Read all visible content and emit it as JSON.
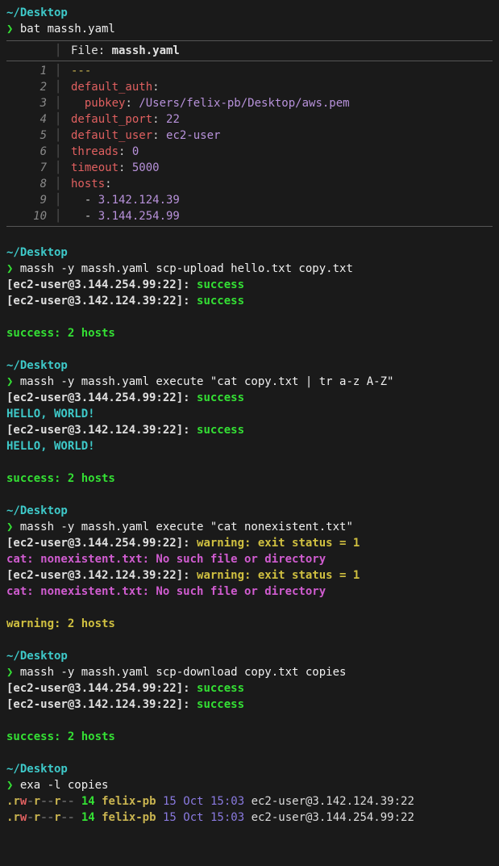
{
  "colors": {
    "bg": "#1a1a1a",
    "cyan": "#3ec9c9",
    "green": "#34e034",
    "red": "#e06060",
    "purple": "#b892db",
    "yellow": "#c9b450",
    "magenta": "#d05cd0"
  },
  "blocks": {
    "bat": {
      "cwd": "~/Desktop",
      "cmd": "bat massh.yaml",
      "file_label": "File: ",
      "filename": "massh.yaml",
      "lines": [
        {
          "num": "1",
          "type": "dashes",
          "text": "---"
        },
        {
          "num": "2",
          "type": "kv",
          "key": "default_auth",
          "colon": ":"
        },
        {
          "num": "3",
          "type": "indent-kv",
          "key": "pubkey",
          "colon": ": ",
          "val": "/Users/felix-pb/Desktop/aws.pem"
        },
        {
          "num": "4",
          "type": "kv-val",
          "key": "default_port",
          "colon": ": ",
          "val": "22"
        },
        {
          "num": "5",
          "type": "kv-val",
          "key": "default_user",
          "colon": ": ",
          "val": "ec2-user"
        },
        {
          "num": "6",
          "type": "kv-val",
          "key": "threads",
          "colon": ": ",
          "val": "0"
        },
        {
          "num": "7",
          "type": "kv-val",
          "key": "timeout",
          "colon": ": ",
          "val": "5000"
        },
        {
          "num": "8",
          "type": "kv",
          "key": "hosts",
          "colon": ":"
        },
        {
          "num": "9",
          "type": "list",
          "dash": "  - ",
          "val": "3.142.124.39"
        },
        {
          "num": "10",
          "type": "list",
          "dash": "  - ",
          "val": "3.144.254.99"
        }
      ]
    },
    "scp_upload": {
      "cwd": "~/Desktop",
      "cmd": "massh -y massh.yaml scp-upload hello.txt copy.txt",
      "results": [
        {
          "tag": "[ec2-user@3.144.254.99:22]: ",
          "status": "success"
        },
        {
          "tag": "[ec2-user@3.142.124.39:22]: ",
          "status": "success"
        }
      ],
      "summary": "success: 2 hosts"
    },
    "exec_cat": {
      "cwd": "~/Desktop",
      "cmd": "massh -y massh.yaml execute \"cat copy.txt | tr a-z A-Z\"",
      "results": [
        {
          "tag": "[ec2-user@3.144.254.99:22]: ",
          "status": "success",
          "out": "HELLO, WORLD!"
        },
        {
          "tag": "[ec2-user@3.142.124.39:22]: ",
          "status": "success",
          "out": "HELLO, WORLD!"
        }
      ],
      "summary": "success: 2 hosts"
    },
    "exec_nonexistent": {
      "cwd": "~/Desktop",
      "cmd": "massh -y massh.yaml execute \"cat nonexistent.txt\"",
      "results": [
        {
          "tag": "[ec2-user@3.144.254.99:22]: ",
          "status": "warning: exit status = 1",
          "out": "cat: nonexistent.txt: No such file or directory"
        },
        {
          "tag": "[ec2-user@3.142.124.39:22]: ",
          "status": "warning: exit status = 1",
          "out": "cat: nonexistent.txt: No such file or directory"
        }
      ],
      "summary": "warning: 2 hosts"
    },
    "scp_download": {
      "cwd": "~/Desktop",
      "cmd": "massh -y massh.yaml scp-download copy.txt copies",
      "results": [
        {
          "tag": "[ec2-user@3.144.254.99:22]: ",
          "status": "success"
        },
        {
          "tag": "[ec2-user@3.142.124.39:22]: ",
          "status": "success"
        }
      ],
      "summary": "success: 2 hosts"
    },
    "exa": {
      "cwd": "~/Desktop",
      "cmd": "exa -l copies",
      "rows": [
        {
          "perm": ".rw-r--r--",
          "size": "14",
          "user": "felix-pb",
          "date": "15 Oct 15:03",
          "name": "ec2-user@3.142.124.39:22"
        },
        {
          "perm": ".rw-r--r--",
          "size": "14",
          "user": "felix-pb",
          "date": "15 Oct 15:03",
          "name": "ec2-user@3.144.254.99:22"
        }
      ]
    }
  }
}
